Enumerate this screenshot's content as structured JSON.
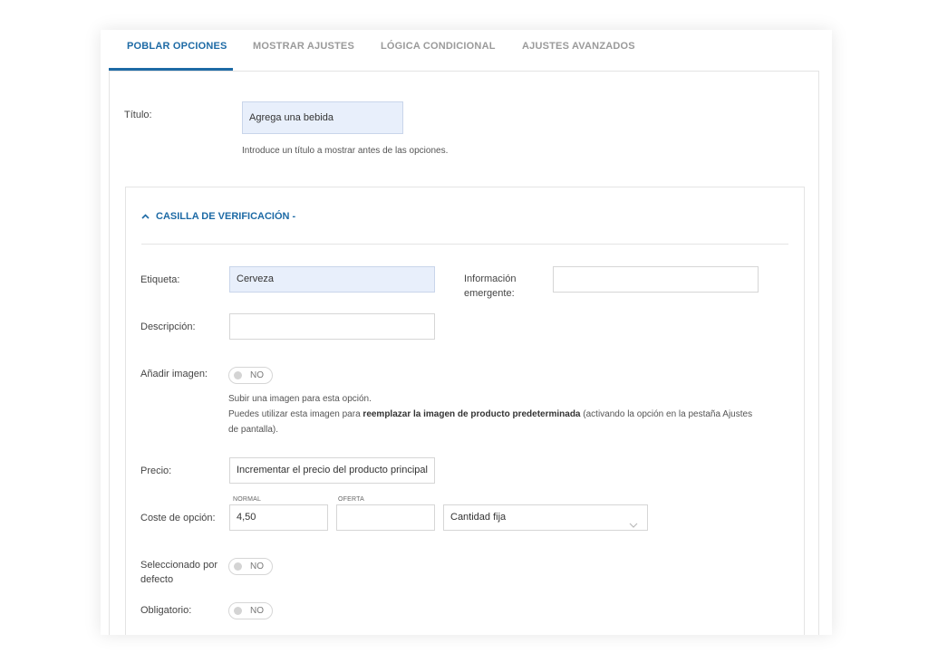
{
  "tabs": [
    {
      "label": "POBLAR OPCIONES",
      "active": true
    },
    {
      "label": "MOSTRAR AJUSTES",
      "active": false
    },
    {
      "label": "LÓGICA CONDICIONAL",
      "active": false
    },
    {
      "label": "AJUSTES AVANZADOS",
      "active": false
    }
  ],
  "title_field": {
    "label": "Título:",
    "value": "Agrega una bebida",
    "hint": "Introduce un título a mostrar antes de las opciones."
  },
  "section": {
    "title": "CASILLA DE VERIFICACIÓN -",
    "icon": "chevron-up-icon"
  },
  "option": {
    "etiqueta": {
      "label": "Etiqueta:",
      "value": "Cerveza"
    },
    "tooltip": {
      "label_line1": "Información",
      "label_line2": "emergente:",
      "value": ""
    },
    "descripcion": {
      "label": "Descripción:",
      "value": ""
    },
    "imagen": {
      "label": "Añadir imagen:",
      "toggle": "NO",
      "hint_line1": "Subir una imagen para esta opción.",
      "hint_line2_pre": "Puedes utilizar esta imagen para ",
      "hint_line2_bold": "reemplazar la imagen de producto predeterminada",
      "hint_line2_post": " (activando la opción en la pestaña Ajustes",
      "hint_line3": "de pantalla)."
    },
    "precio": {
      "label": "Precio:",
      "value": "Incrementar el precio del producto principal"
    },
    "coste": {
      "label": "Coste de opción:",
      "normal_label": "NORMAL",
      "normal_value": "4,50",
      "oferta_label": "OFERTA",
      "oferta_value": "",
      "type_value": "Cantidad fija"
    },
    "seleccionado": {
      "label_line1": "Seleccionado por",
      "label_line2": "defecto",
      "toggle": "NO"
    },
    "obligatorio": {
      "label": "Obligatorio:",
      "toggle": "NO"
    }
  },
  "colors": {
    "accent": "#1d6aa5",
    "filled_input": "#e8effb"
  }
}
